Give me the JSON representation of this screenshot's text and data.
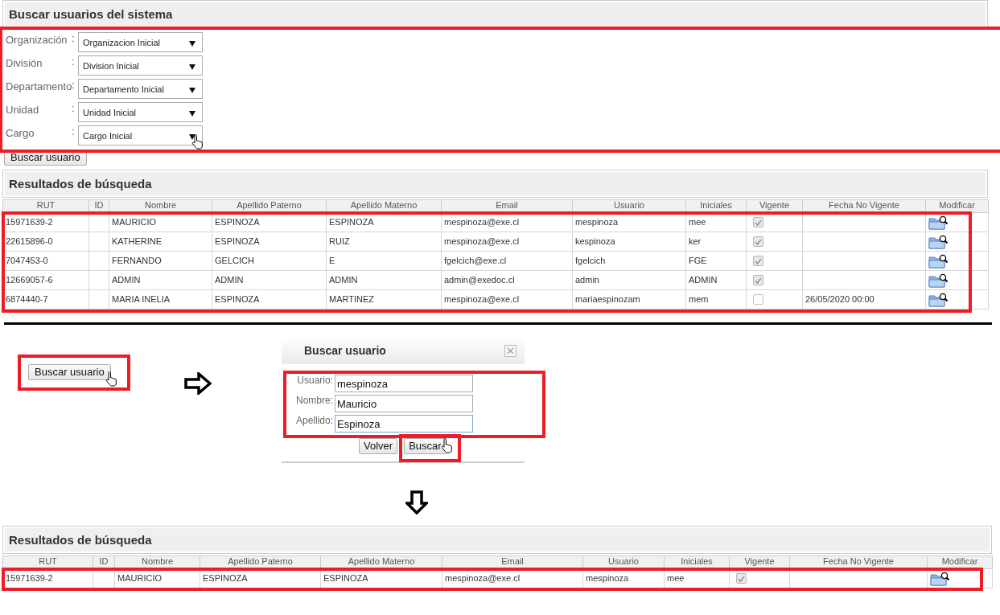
{
  "search_panel": {
    "title": "Buscar usuarios del sistema",
    "filters": [
      {
        "label": "Organización",
        "separator": ":",
        "value": "Organizacion Inicial"
      },
      {
        "label": "División",
        "separator": ":",
        "value": "Division Inicial"
      },
      {
        "label": "Departamento",
        "separator": ":",
        "value": "Departamento Inicial"
      },
      {
        "label": "Unidad",
        "separator": ":",
        "value": "Unidad Inicial"
      },
      {
        "label": "Cargo",
        "separator": ":",
        "value": "Cargo Inicial"
      }
    ],
    "search_button": "Buscar usuario"
  },
  "results_panel": {
    "title": "Resultados de búsqueda",
    "columns": [
      "RUT",
      "ID",
      "Nombre",
      "Apellido Paterno",
      "Apellido Materno",
      "Email",
      "Usuario",
      "Iniciales",
      "Vigente",
      "Fecha No Vigente",
      "Modificar"
    ],
    "rows": [
      {
        "rut": "15971639-2",
        "nombre": "MAURICIO",
        "apellido_paterno": "ESPINOZA",
        "apellido_materno": "ESPINOZA",
        "email": "mespinoza@exe.cl",
        "usuario": "mespinoza",
        "iniciales": "mee",
        "vigente": true
      },
      {
        "rut": "22615896-0",
        "nombre": "KATHERINE",
        "apellido_paterno": "ESPINOZA",
        "apellido_materno": "RUIZ",
        "email": "mespinoza@exe.cl",
        "usuario": "kespinoza",
        "iniciales": "ker",
        "vigente": true
      },
      {
        "rut": "7047453-0",
        "nombre": "FERNANDO",
        "apellido_paterno": "GELCICH",
        "apellido_materno": "E",
        "email": "fgelcich@exe.cl",
        "usuario": "fgelcich",
        "iniciales": "FGE",
        "vigente": true
      },
      {
        "rut": "12669057-6",
        "nombre": "ADMIN",
        "apellido_paterno": "ADMIN",
        "apellido_materno": "ADMIN",
        "email": "admin@exedoc.cl",
        "usuario": "admin",
        "iniciales": "ADMIN",
        "vigente": true
      },
      {
        "rut": "6874440-7",
        "nombre": "MARIA INELIA",
        "apellido_paterno": "ESPINOZA",
        "apellido_materno": "MARTINEZ",
        "email": "mespinoza@exe.cl",
        "usuario": "mariaespinozam",
        "iniciales": "mem",
        "vigente": false,
        "fecha_no_vigente": "26/05/2020 00:00"
      }
    ]
  },
  "step_button": "Buscar usuario",
  "dialog": {
    "title": "Buscar usuario",
    "fields": [
      {
        "label": "Usuario:",
        "value": "mespinoza",
        "focused": false
      },
      {
        "label": "Nombre:",
        "value": "Mauricio",
        "focused": false
      },
      {
        "label": "Apellido:",
        "value": "Espinoza",
        "focused": true
      }
    ],
    "buttons": [
      "Volver",
      "Buscar"
    ]
  },
  "filtered_results": {
    "title": "Resultados de búsqueda",
    "columns": [
      "RUT",
      "ID",
      "Nombre",
      "Apellido Paterno",
      "Apellido Materno",
      "Email",
      "Usuario",
      "Iniciales",
      "Vigente",
      "Fecha No Vigente",
      "Modificar"
    ],
    "rows": [
      {
        "rut": "15971639-2",
        "nombre": "MAURICIO",
        "apellido_paterno": "ESPINOZA",
        "apellido_materno": "ESPINOZA",
        "email": "mespinoza@exe.cl",
        "usuario": "mespinoza",
        "iniciales": "mee",
        "vigente": true
      }
    ]
  }
}
